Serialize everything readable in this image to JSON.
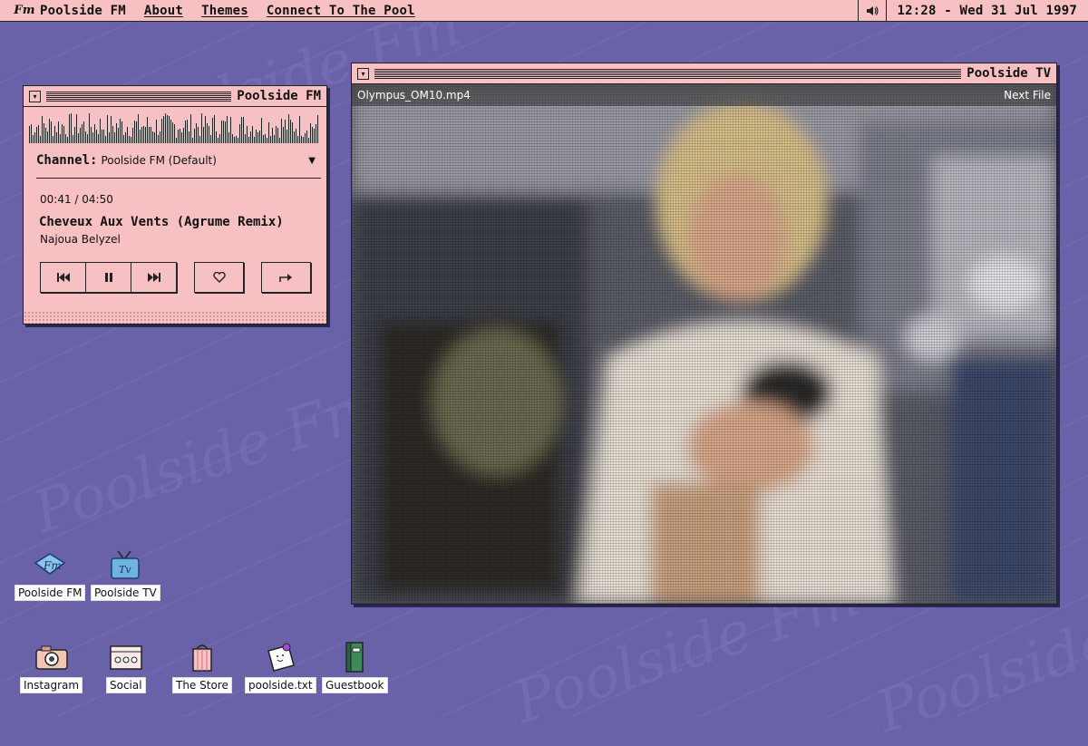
{
  "menubar": {
    "logo": "Fm",
    "app_name": "Poolside FM",
    "items": [
      "About",
      "Themes",
      "Connect To The Pool"
    ],
    "volume_icon": "speaker-icon",
    "clock": "12:28 - Wed 31 Jul 1997"
  },
  "radio": {
    "title": "Poolside FM",
    "channel_label": "Channel:",
    "channel_value": "Poolside FM (Default)",
    "time": "00:41 / 04:50",
    "track": "Cheveux Aux Vents (Agrume Remix)",
    "artist": "Najoua Belyzel",
    "buttons": [
      "previous-icon",
      "pause-icon",
      "next-icon",
      "heart-icon",
      "share-icon"
    ]
  },
  "tv": {
    "title": "Poolside TV",
    "filename": "Olympus_OM10.mp4",
    "next_label": "Next File"
  },
  "desktop": {
    "watermark": "Poolside Fm",
    "icons_row1": [
      {
        "label": "Poolside FM",
        "icon": "poolside-fm-icon"
      },
      {
        "label": "Poolside TV",
        "icon": "tv-icon"
      }
    ],
    "icons_row2": [
      {
        "label": "Instagram",
        "icon": "camera-icon"
      },
      {
        "label": "Social",
        "icon": "social-window-icon"
      },
      {
        "label": "The Store",
        "icon": "shopping-bag-icon"
      },
      {
        "label": "poolside.txt",
        "icon": "note-icon"
      },
      {
        "label": "Guestbook",
        "icon": "book-icon"
      }
    ]
  },
  "colors": {
    "desktop": "#6a62a8",
    "window": "#f7c0c2",
    "border": "#222222"
  }
}
